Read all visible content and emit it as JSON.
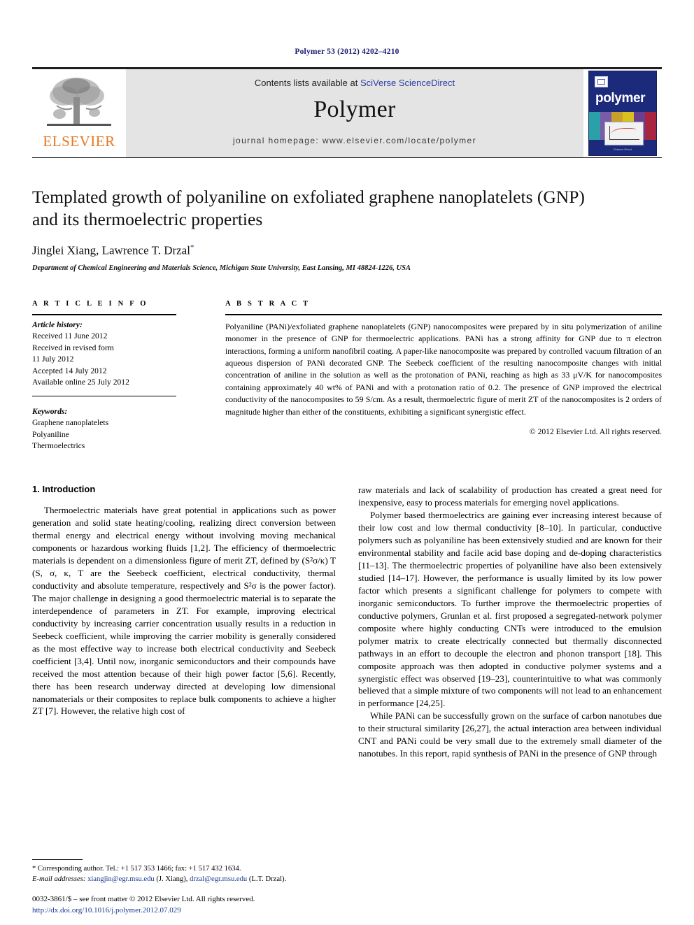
{
  "running_head": "Polymer 53 (2012) 4202–4210",
  "masthead": {
    "publisher_name": "ELSEVIER",
    "contents_prefix": "Contents lists available at ",
    "contents_link": "SciVerse ScienceDirect",
    "journal_title": "Polymer",
    "homepage": "journal homepage: www.elsevier.com/locate/polymer",
    "cover_word": "polymer",
    "cover_footer": "Science Direct"
  },
  "article": {
    "title": "Templated growth of polyaniline on exfoliated graphene nanoplatelets (GNP) and its thermoelectric properties",
    "authors": "Jinglei Xiang, Lawrence T. Drzal",
    "corresponding_marker": "*",
    "affiliation": "Department of Chemical Engineering and Materials Science, Michigan State University, East Lansing, MI 48824-1226, USA"
  },
  "article_info": {
    "heading": "A R T I C L E   I N F O",
    "history_label": "Article history:",
    "history": [
      "Received 11 June 2012",
      "Received in revised form",
      "11 July 2012",
      "Accepted 14 July 2012",
      "Available online 25 July 2012"
    ],
    "keywords_label": "Keywords:",
    "keywords": [
      "Graphene nanoplatelets",
      "Polyaniline",
      "Thermoelectrics"
    ]
  },
  "abstract": {
    "heading": "A B S T R A C T",
    "text": "Polyaniline (PANi)/exfoliated graphene nanoplatelets (GNP) nanocomposites were prepared by in situ polymerization of aniline monomer in the presence of GNP for thermoelectric applications. PANi has a strong affinity for GNP due to π electron interactions, forming a uniform nanofibril coating. A paper-like nanocomposite was prepared by controlled vacuum filtration of an aqueous dispersion of PANi decorated GNP. The Seebeck coefficient of the resulting nanocomposite changes with initial concentration of aniline in the solution as well as the protonation of PANi, reaching as high as 33 μV/K for nanocomposites containing approximately 40 wt% of PANi and with a protonation ratio of 0.2. The presence of GNP improved the electrical conductivity of the nanocomposites to 59 S/cm. As a result, thermoelectric figure of merit ZT of the nanocomposites is 2 orders of magnitude higher than either of the constituents, exhibiting a significant synergistic effect.",
    "copyright": "© 2012 Elsevier Ltd. All rights reserved."
  },
  "introduction": {
    "section_number_title": "1. Introduction",
    "left_paragraph_1": "Thermoelectric materials have great potential in applications such as power generation and solid state heating/cooling, realizing direct conversion between thermal energy and electrical energy without involving moving mechanical components or hazardous working fluids [1,2]. The efficiency of thermoelectric materials is dependent on a dimensionless figure of merit ZT, defined by (S²σ/κ) T (S, σ, κ, T are the Seebeck coefficient, electrical conductivity, thermal conductivity and absolute temperature, respectively and S²σ is the power factor). The major challenge in designing a good thermoelectric material is to separate the interdependence of parameters in ZT. For example, improving electrical conductivity by increasing carrier concentration usually results in a reduction in Seebeck coefficient, while improving the carrier mobility is generally considered as the most effective way to increase both electrical conductivity and Seebeck coefficient [3,4]. Until now, inorganic semiconductors and their compounds have received the most attention because of their high power factor [5,6]. Recently, there has been research underway directed at developing low dimensional nanomaterials or their composites to replace bulk components to achieve a higher ZT [7]. However, the relative high cost of",
    "right_paragraph_1_continued": "raw materials and lack of scalability of production has created a great need for inexpensive, easy to process materials for emerging novel applications.",
    "right_paragraph_2": "Polymer based thermoelectrics are gaining ever increasing interest because of their low cost and low thermal conductivity [8–10]. In particular, conductive polymers such as polyaniline has been extensively studied and are known for their environmental stability and facile acid base doping and de-doping characteristics [11–13]. The thermoelectric properties of polyaniline have also been extensively studied [14–17]. However, the performance is usually limited by its low power factor which presents a significant challenge for polymers to compete with inorganic semiconductors. To further improve the thermoelectric properties of conductive polymers, Grunlan et al. first proposed a segregated-network polymer composite where highly conducting CNTs were introduced to the emulsion polymer matrix to create electrically connected but thermally disconnected pathways in an effort to decouple the electron and phonon transport [18]. This composite approach was then adopted in conductive polymer systems and a synergistic effect was observed [19–23], counterintuitive to what was commonly believed that a simple mixture of two components will not lead to an enhancement in performance [24,25].",
    "right_paragraph_3": "While PANi can be successfully grown on the surface of carbon nanotubes due to their structural similarity [26,27], the actual interaction area between individual CNT and PANi could be very small due to the extremely small diameter of the nanotubes. In this report, rapid synthesis of PANi in the presence of GNP through"
  },
  "footnote": {
    "corresponding": "* Corresponding author. Tel.: +1 517 353 1466; fax: +1 517 432 1634.",
    "email_label": "E-mail addresses:",
    "email_1": "xiangjin@egr.msu.edu",
    "email_1_owner": "(J. Xiang),",
    "email_2": "drzal@egr.msu.edu",
    "email_2_owner": "(L.T. Drzal)."
  },
  "issn": {
    "line": "0032-3861/$ – see front matter © 2012 Elsevier Ltd. All rights reserved.",
    "doi": "http://dx.doi.org/10.1016/j.polymer.2012.07.029"
  },
  "colors": {
    "link_blue": "#2b3fa0",
    "elsevier_orange": "#E87722",
    "reference_blue": "#1a3a8f",
    "cover_blue": "#1b2a7a",
    "masthead_gray": "#e4e4e4"
  }
}
